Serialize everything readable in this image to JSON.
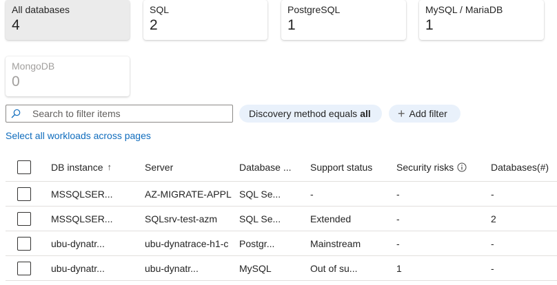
{
  "cards": [
    {
      "label": "All databases",
      "count": "4"
    },
    {
      "label": "SQL",
      "count": "2"
    },
    {
      "label": "PostgreSQL",
      "count": "1"
    },
    {
      "label": "MySQL / MariaDB",
      "count": "1"
    },
    {
      "label": "MongoDB",
      "count": "0"
    }
  ],
  "search": {
    "placeholder": "Search to filter items",
    "value": ""
  },
  "filters": {
    "discovery_prefix": "Discovery method equals",
    "discovery_value": "all",
    "add_filter_label": "Add filter"
  },
  "select_all_label": "Select all workloads across pages",
  "table": {
    "columns": [
      "DB instance",
      "Server",
      "Database ...",
      "Support status",
      "Security risks",
      "Databases(#)"
    ],
    "sort_indicator": "↑",
    "rows": [
      {
        "instance": "MSSQLSER...",
        "server": "AZ-MIGRATE-APPL",
        "db_type": "SQL Se...",
        "support": "-",
        "risks": "-",
        "databases": "-"
      },
      {
        "instance": "MSSQLSER...",
        "server": "SQLsrv-test-azm",
        "db_type": "SQL Se...",
        "support": "Extended",
        "risks": "-",
        "databases": "2"
      },
      {
        "instance": "ubu-dynatr...",
        "server": "ubu-dynatrace-h1-c",
        "db_type": "Postgr...",
        "support": "Mainstream",
        "risks": "-",
        "databases": "-"
      },
      {
        "instance": "ubu-dynatr...",
        "server": "ubu-dynatr...",
        "db_type": "MySQL",
        "support": "Out of su...",
        "risks": "1",
        "databases": "-"
      }
    ]
  },
  "colors": {
    "link": "#0f6cbd",
    "selected_card": "#ebebeb",
    "pill": "#e9f1fb"
  }
}
